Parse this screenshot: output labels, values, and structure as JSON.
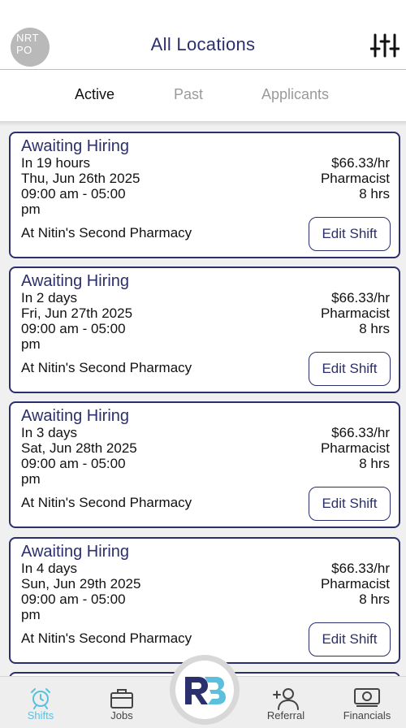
{
  "header": {
    "avatar_initials_line1": "NRT",
    "avatar_initials_line2": "PO",
    "title": "All Locations",
    "filter_icon": "sliders-icon"
  },
  "tabs": [
    {
      "label": "Active",
      "selected": true
    },
    {
      "label": "Past",
      "selected": false
    },
    {
      "label": "Applicants",
      "selected": false
    }
  ],
  "shifts": [
    {
      "status": "Awaiting Hiring",
      "relative": "In 19 hours",
      "date": "Thu, Jun 26th 2025",
      "time_line1": "09:00 am - 05:00",
      "time_line2": "pm",
      "rate": "$66.33/hr",
      "role": "Pharmacist",
      "duration": "8 hrs",
      "location": "At Nitin's Second Pharmacy",
      "edit_label": "Edit Shift"
    },
    {
      "status": "Awaiting Hiring",
      "relative": "In 2 days",
      "date": "Fri, Jun 27th 2025",
      "time_line1": "09:00 am - 05:00",
      "time_line2": "pm",
      "rate": "$66.33/hr",
      "role": "Pharmacist",
      "duration": "8 hrs",
      "location": "At Nitin's Second Pharmacy",
      "edit_label": "Edit Shift"
    },
    {
      "status": "Awaiting Hiring",
      "relative": "In 3 days",
      "date": "Sat, Jun 28th 2025",
      "time_line1": "09:00 am - 05:00",
      "time_line2": "pm",
      "rate": "$66.33/hr",
      "role": "Pharmacist",
      "duration": "8 hrs",
      "location": "At Nitin's Second Pharmacy",
      "edit_label": "Edit Shift"
    },
    {
      "status": "Awaiting Hiring",
      "relative": "In 4 days",
      "date": "Sun, Jun 29th 2025",
      "time_line1": "09:00 am - 05:00",
      "time_line2": "pm",
      "rate": "$66.33/hr",
      "role": "Pharmacist",
      "duration": "8 hrs",
      "location": "At Nitin's Second Pharmacy",
      "edit_label": "Edit Shift"
    }
  ],
  "bottom_nav": {
    "shifts": {
      "label": "Shifts",
      "icon": "alarm-clock-icon",
      "active": true
    },
    "jobs": {
      "label": "Jobs",
      "icon": "briefcase-icon"
    },
    "center": {
      "icon": "rb-logo-icon"
    },
    "referral": {
      "label": "Referral",
      "icon": "add-user-icon"
    },
    "financials": {
      "label": "Financials",
      "icon": "money-icon"
    }
  },
  "colors": {
    "brand_navy": "#2b2f6b",
    "brand_teal": "#5bc0de",
    "list_background": "#f0f0f0"
  }
}
